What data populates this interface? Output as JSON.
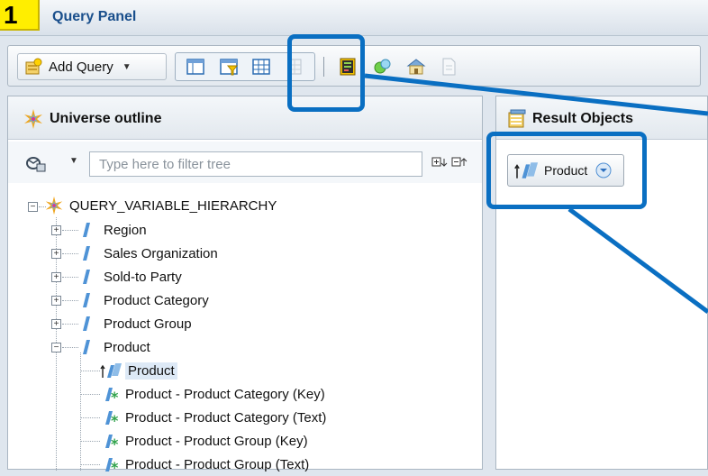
{
  "window": {
    "step_number": "1",
    "title": "Query Panel"
  },
  "toolbar": {
    "add_query_label": "Add Query",
    "add_query_icon": "add-query-icon",
    "view_buttons": [
      "query-design-icon",
      "filter-pane-icon",
      "data-preview-icon",
      "grid-icon"
    ],
    "extra_buttons": [
      "sql-viewer-icon",
      "refresh-icon",
      "properties-icon",
      "document-icon"
    ]
  },
  "universe_outline": {
    "title": "Universe outline",
    "filter_placeholder": "Type here to filter tree",
    "root": "QUERY_VARIABLE_HIERARCHY",
    "items": [
      {
        "label": "Region",
        "expanded": false
      },
      {
        "label": "Sales Organization",
        "expanded": false
      },
      {
        "label": "Sold-to Party",
        "expanded": false
      },
      {
        "label": "Product Category",
        "expanded": false
      },
      {
        "label": "Product Group",
        "expanded": false
      },
      {
        "label": "Product",
        "expanded": true
      }
    ],
    "product_children": [
      {
        "label": "Product",
        "type": "hierarchy",
        "selected": true
      },
      {
        "label": "Product - Product Category (Key)",
        "type": "attribute"
      },
      {
        "label": "Product - Product Category (Text)",
        "type": "attribute"
      },
      {
        "label": "Product - Product Group (Key)",
        "type": "attribute"
      },
      {
        "label": "Product - Product Group (Text)",
        "type": "attribute"
      }
    ]
  },
  "result_objects": {
    "title": "Result Objects",
    "chip_label": "Product"
  },
  "colors": {
    "callout": "#0a6fc2",
    "badge": "#ffee00",
    "title_text": "#1a4f8c",
    "selection": "#dde9f6"
  }
}
